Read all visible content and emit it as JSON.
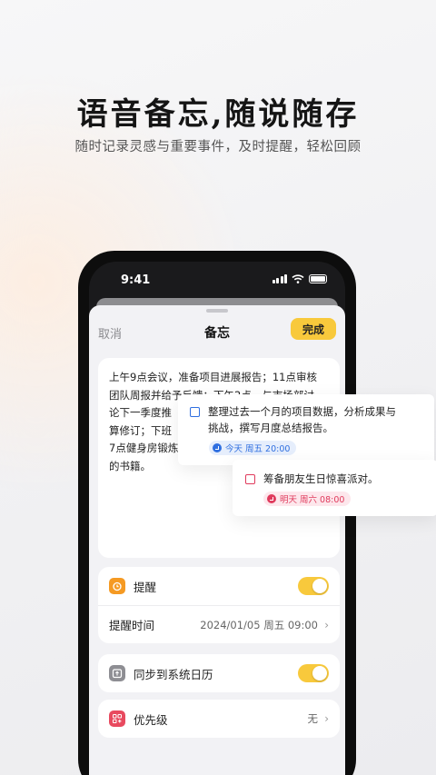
{
  "promo": {
    "headline": "语音备忘,随说随存",
    "subline": "随时记录灵感与重要事件，及时提醒，轻松回顾"
  },
  "status_bar": {
    "time": "9:41"
  },
  "sheet": {
    "cancel_label": "取消",
    "title": "备忘",
    "done_label": "完成"
  },
  "note": {
    "text": "上午9点会议，准备项目进展报告；11点审核团队周报并给予反馈；下午2点、与市场部讨论下一季度推广策略；下午4点准备修订；下班后7点健身房锻炼，睡前阅读半小时的书籍。",
    "visible_lines": [
      "上午9点会议，准备项目进展报告；11点审核",
      "团队周报并给予反馈；下午2点、与市场部讨",
      "论下一季度推",
      "算修订；下班",
      "7点健身房锻炼",
      "的书籍。"
    ]
  },
  "settings": {
    "reminder_label": "提醒",
    "reminder_on": true,
    "reminder_time_label": "提醒时间",
    "reminder_time_value": "2024/01/05 周五 09:00",
    "sync_label": "同步到系统日历",
    "sync_on": true,
    "priority_label": "优先级",
    "priority_value": "无"
  },
  "todos": [
    {
      "text_lines": [
        "整理过去一个月的项目数据，分析成果与",
        "挑战，撰写月度总结报告。"
      ],
      "tag": "今天 周五 20:00",
      "color": "#2f6fe0",
      "tag_bg": "#e6eefc"
    },
    {
      "text_lines": [
        "筹备朋友生日惊喜派对。"
      ],
      "tag": "明天 周六 08:00",
      "color": "#e03a5c",
      "tag_bg": "#fde7ec"
    }
  ],
  "colors": {
    "accent": "#f8c93c",
    "reminder_icon": "#f59a23",
    "sync_icon": "#8e8e93",
    "priority_icon": "#e84a5f"
  },
  "icons": {
    "reminder": "alarm-clock-icon",
    "sync": "calendar-upload-icon",
    "priority": "grid-plus-icon",
    "chevron": "chevron-right-icon"
  }
}
